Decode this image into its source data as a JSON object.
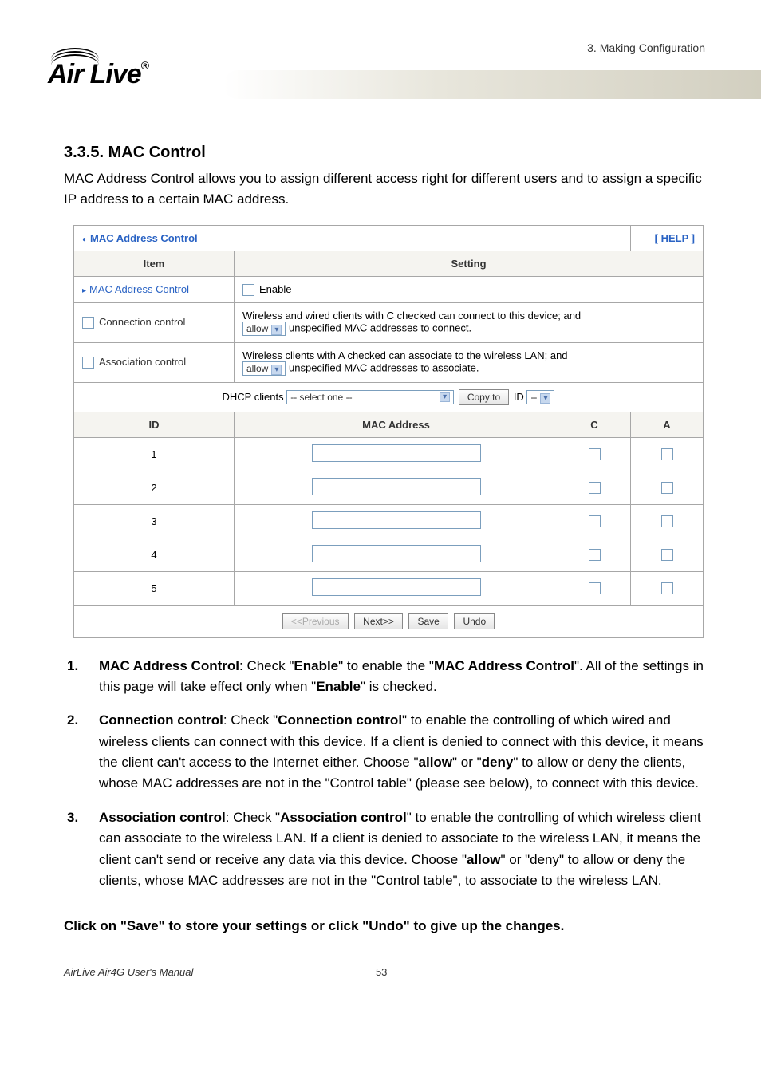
{
  "header": {
    "crumb": "3. Making Configuration",
    "logo_text": "Air Live",
    "logo_reg": "®"
  },
  "section": {
    "number_title": "3.3.5.  MAC Control",
    "lead": "MAC Address Control allows you to assign different access right for different users and to assign a specific IP address to a certain MAC address."
  },
  "ui": {
    "panel_title": "MAC Address Control",
    "help": "[ HELP ]",
    "col_item": "Item",
    "col_setting": "Setting",
    "r1_label": "MAC Address Control",
    "r1_enable": "Enable",
    "r2_label": "Connection control",
    "r2_text_a": "Wireless and wired clients with C checked can connect to this device; and",
    "r2_sel": "allow",
    "r2_text_b": "unspecified MAC addresses to connect.",
    "r3_label": "Association control",
    "r3_text_a": "Wireless clients with A checked can associate to the wireless LAN; and",
    "r3_sel": "allow",
    "r3_text_b": "unspecified MAC addresses to associate.",
    "dhcp_label": "DHCP clients",
    "dhcp_sel": "-- select one --",
    "copy_btn": "Copy to",
    "id_label": "ID",
    "id_sel": "--",
    "hdr_id": "ID",
    "hdr_mac": "MAC Address",
    "hdr_c": "C",
    "hdr_a": "A",
    "rows": [
      "1",
      "2",
      "3",
      "4",
      "5"
    ],
    "btn_prev": "<<Previous",
    "btn_next": "Next>>",
    "btn_save": "Save",
    "btn_undo": "Undo"
  },
  "list": {
    "i1_num": "1.",
    "i1_a": "MAC Address Control",
    "i1_b": ": Check \"",
    "i1_c": "Enable",
    "i1_d": "\" to enable the \"",
    "i1_e": "MAC Address Control",
    "i1_f": "\". All of the settings in this page will take effect only when \"",
    "i1_g": "Enable",
    "i1_h": "\" is checked.",
    "i2_num": "2.",
    "i2_a": "Connection control",
    "i2_b": ": Check \"",
    "i2_c": "Connection control",
    "i2_d": "\" to enable the controlling of which wired and wireless clients can connect with this device. If a client is denied to connect with this device, it means the client can't access to the Internet either. Choose \"",
    "i2_e": "allow",
    "i2_f": "\" or \"",
    "i2_g": "deny",
    "i2_h": "\" to allow or deny the clients, whose MAC addresses are not in the \"Control table\" (please see below), to connect with this device.",
    "i3_num": "3.",
    "i3_a": "Association control",
    "i3_b": ": Check \"",
    "i3_c": "Association control",
    "i3_d": "\" to enable the controlling of which wireless client can associate to the wireless LAN. If a client is denied to associate to the wireless LAN, it means the client can't send or receive any data via this device. Choose \"",
    "i3_e": "allow",
    "i3_f": "\" or \"deny\" to allow or deny the clients, whose MAC addresses are not in the \"Control table\", to associate to the wireless LAN."
  },
  "closing": "Click on \"Save\" to store your settings or click \"Undo\" to give up the changes.",
  "footer": {
    "left": "AirLive Air4G User's Manual",
    "page": "53"
  }
}
